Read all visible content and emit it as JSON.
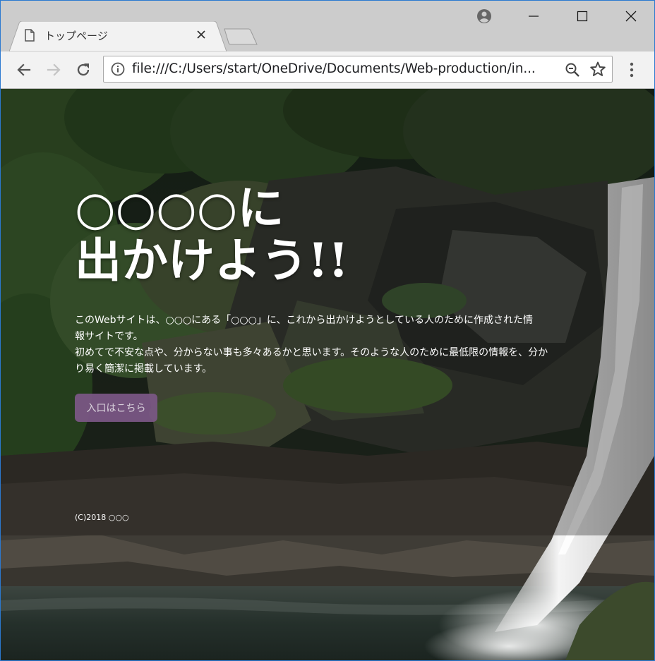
{
  "browser": {
    "tab": {
      "title": "トップページ"
    },
    "address_bar": {
      "url": "file:///C:/Users/start/OneDrive/Documents/Web-production/in..."
    },
    "icons": {
      "tab_page": "page-icon",
      "tab_close": "close-icon",
      "new_tab": "new-tab-icon",
      "profile": "account-icon",
      "minimize": "minimize-icon",
      "maximize": "maximize-icon",
      "close_window": "close-icon",
      "back": "arrow-left-icon",
      "forward": "arrow-right-icon",
      "reload": "reload-icon",
      "site_info": "info-icon",
      "zoom": "zoom-out-icon",
      "bookmark": "star-icon",
      "menu": "more-vert-icon"
    },
    "colors": {
      "frame": "#cccccc",
      "toolbar": "#f2f2f2",
      "window_border": "#2b79d0"
    }
  },
  "page": {
    "hero": {
      "heading_line1": "○○○○に",
      "heading_line2": "出かけよう!!",
      "description_line1": "このWebサイトは、○○○にある「○○○」に、これから出かけようとしている人のために作成された情",
      "description_line2": "報サイトです。",
      "description_line3": "初めてで不安な点や、分からない事も多々あるかと思います。そのような人のために最低限の情報を、分か",
      "description_line4": "り易く簡潔に掲載しています。",
      "button_label": "入口はこちら"
    },
    "footer": {
      "copyright": "(C)2018 ○○○"
    },
    "colors": {
      "button_bg": "#7c5887",
      "text": "#ffffff"
    }
  }
}
